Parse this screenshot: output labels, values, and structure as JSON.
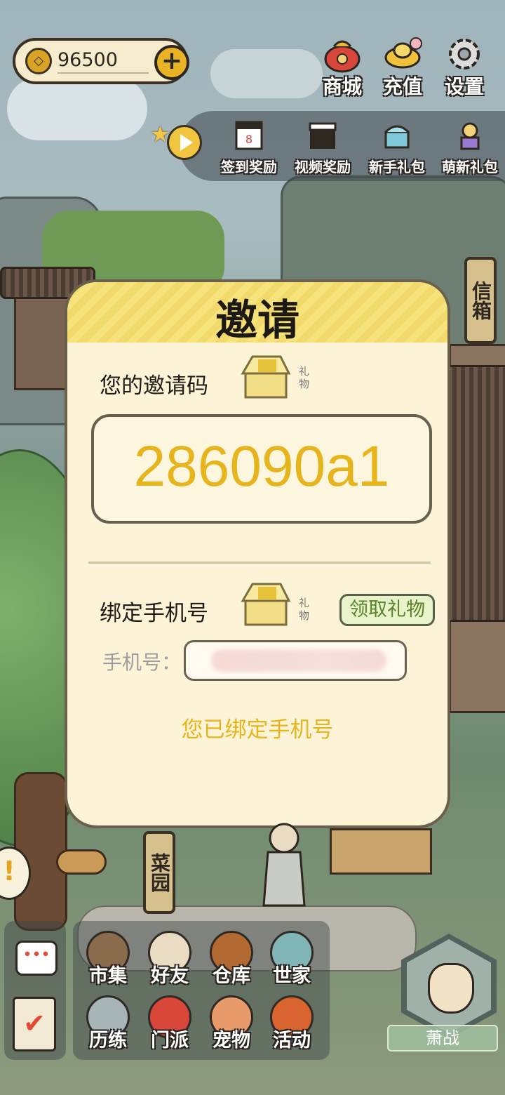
{
  "currency": {
    "amount": "96500"
  },
  "top_menu": [
    {
      "label": "商城",
      "icon": "shop-bag-icon"
    },
    {
      "label": "充值",
      "icon": "gold-ingot-icon"
    },
    {
      "label": "设置",
      "icon": "gear-icon"
    }
  ],
  "rewards": [
    {
      "label": "签到奖励",
      "icon": "calendar-icon"
    },
    {
      "label": "视频奖励",
      "icon": "clapperboard-icon"
    },
    {
      "label": "新手礼包",
      "icon": "chest-icon"
    },
    {
      "label": "萌新礼包",
      "icon": "sprite-icon"
    }
  ],
  "signs": {
    "mailbox": "信箱",
    "garden": "菜园"
  },
  "dialog": {
    "title": "邀请",
    "invite_label": "您的邀请码",
    "gift_label": "礼物",
    "invite_code": "286090a1",
    "bind_label": "绑定手机号",
    "claim_button": "领取礼物",
    "phone_label": "手机号：",
    "bound_message": "您已绑定手机号"
  },
  "bottom_menu": [
    {
      "label": "市集",
      "icon": "market-icon"
    },
    {
      "label": "好友",
      "icon": "handshake-icon"
    },
    {
      "label": "仓库",
      "icon": "treasure-chest-icon"
    },
    {
      "label": "世家",
      "icon": "robe-icon"
    },
    {
      "label": "历练",
      "icon": "crossed-swords-icon"
    },
    {
      "label": "门派",
      "icon": "banner-icon"
    },
    {
      "label": "宠物",
      "icon": "paw-icon"
    },
    {
      "label": "活动",
      "icon": "lantern-icon"
    }
  ],
  "character": {
    "name": "萧战"
  },
  "colors": {
    "accent_gold": "#e6b41d",
    "claim_green": "#59822d",
    "dialog_bg": "#fdf3d7"
  }
}
